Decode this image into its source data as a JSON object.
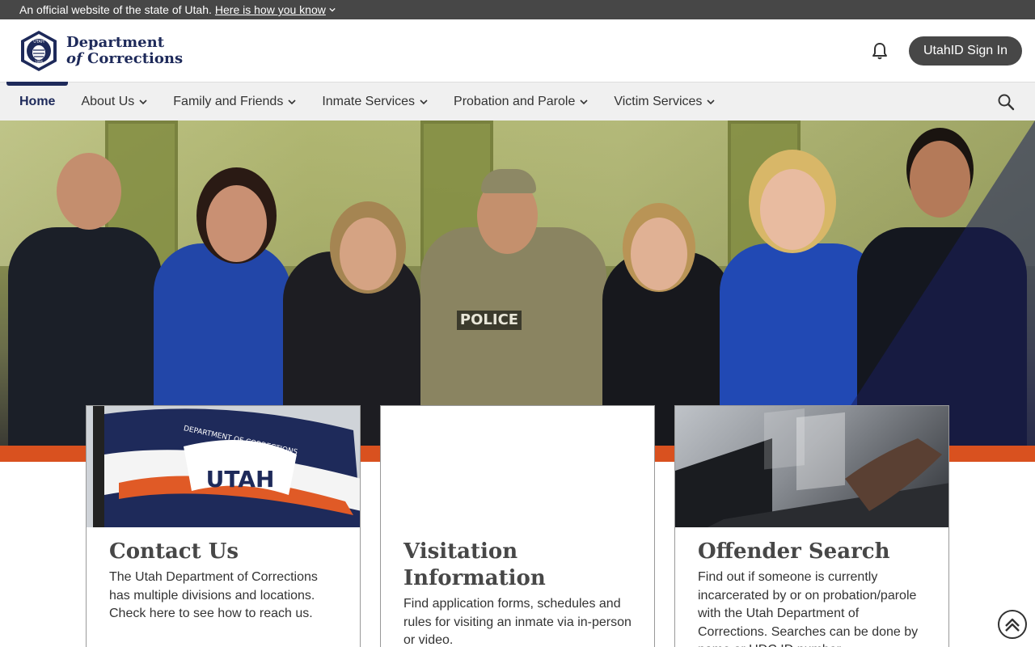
{
  "official_banner": {
    "text": "An official website of the state of Utah.",
    "link": "Here is how you know"
  },
  "header": {
    "logo_line1": "Department",
    "logo_line2_of": "of",
    "logo_line2_rest": " Corrections",
    "seal_text_top": "UTAH",
    "seal_text_bottom": "1896",
    "signin_label": "UtahID Sign In"
  },
  "nav": {
    "items": [
      {
        "label": "Home",
        "active": true
      },
      {
        "label": "About Us"
      },
      {
        "label": "Family and Friends"
      },
      {
        "label": "Inmate Services"
      },
      {
        "label": "Probation and Parole"
      },
      {
        "label": "Victim Services"
      }
    ]
  },
  "hero": {
    "patch_text": "POLICE"
  },
  "cards": [
    {
      "title": "Contact Us",
      "description": "The Utah Department of Corrections has multiple divisions and locations. Check here to see how to reach us.",
      "flag_arc": "DEPARTMENT OF CORRECTIONS",
      "flag_main": "UTAH"
    },
    {
      "title": "Visitation Information",
      "description": "Find application forms, schedules and rules for visiting an inmate via in-person or video."
    },
    {
      "title": "Offender Search",
      "description": "Find out if someone is currently incarcerated by or on probation/parole with the Utah Department of Corrections. Searches can be done by name or UDC ID number."
    }
  ],
  "colors": {
    "brand_navy": "#1e2a5a",
    "accent_orange": "#d9511f",
    "dark_gray": "#474747"
  }
}
